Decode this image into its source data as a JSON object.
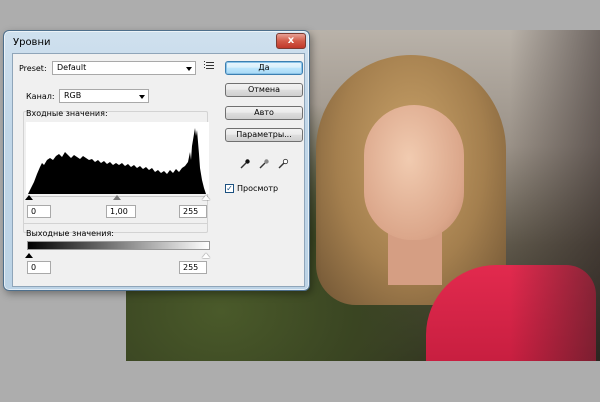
{
  "dialog": {
    "title": "Уровни",
    "close_glyph": "x"
  },
  "preset": {
    "label": "Preset:",
    "value": "Default",
    "menu_icon": "preset-options-icon"
  },
  "channel": {
    "label": "Канал:",
    "value": "RGB"
  },
  "input_levels": {
    "label": "Входные значения:",
    "black": "0",
    "gamma": "1,00",
    "white": "255"
  },
  "output_levels": {
    "label": "Выходные значения:",
    "black": "0",
    "white": "255"
  },
  "buttons": {
    "ok": "Да",
    "cancel": "Отмена",
    "auto": "Авто",
    "options": "Параметры..."
  },
  "eyedroppers": [
    "black-eyedropper-icon",
    "gray-eyedropper-icon",
    "white-eyedropper-icon"
  ],
  "preview": {
    "label": "Просмотр",
    "checked": true
  },
  "colors": {
    "dialog_frame": "#bcd3e6",
    "close_button": "#c0392b",
    "default_button": "#bee6fd",
    "photo_shirt": "#e22a4e"
  }
}
